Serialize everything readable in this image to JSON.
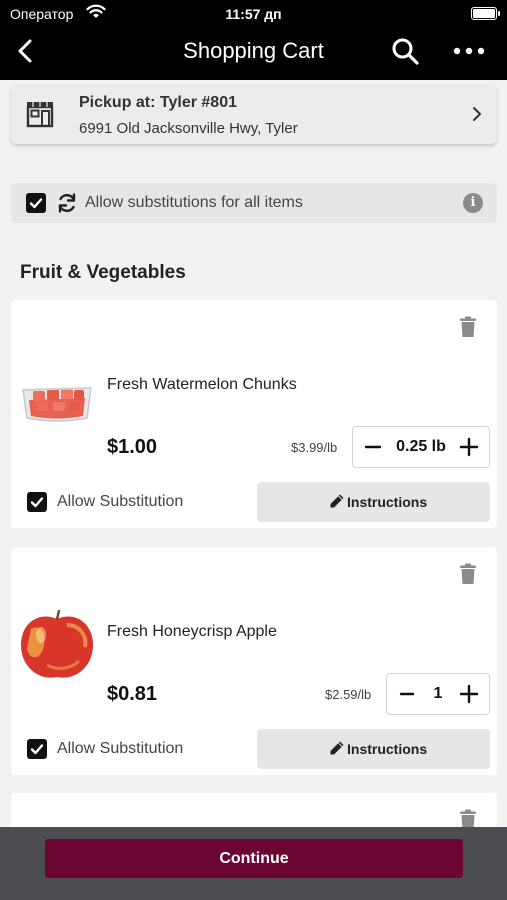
{
  "status_bar": {
    "carrier": "Оператор",
    "time": "11:57 дп",
    "battery_level": 1.0
  },
  "header": {
    "title": "Shopping Cart"
  },
  "pickup": {
    "line1": "Pickup at: Tyler #801",
    "line2": "6991 Old Jacksonville Hwy, Tyler"
  },
  "substitutions_all": {
    "checked": true,
    "label": "Allow substitutions for all items"
  },
  "section": {
    "title": "Fruit & Vegetables"
  },
  "items": [
    {
      "name": "Fresh Watermelon Chunks",
      "price": "$1.00",
      "unit_price": "$3.99/lb",
      "quantity": "0.25 lb",
      "allow_substitution": true,
      "substitution_label": "Allow Substitution",
      "instructions_label": "Instructions"
    },
    {
      "name": "Fresh Honeycrisp Apple",
      "price": "$0.81",
      "unit_price": "$2.59/lb",
      "quantity": "1",
      "allow_substitution": true,
      "substitution_label": "Allow Substitution",
      "instructions_label": "Instructions"
    }
  ],
  "footer": {
    "continue_label": "Continue"
  },
  "colors": {
    "header_bg": "#000000",
    "continue_bg": "#6b0633",
    "footer_bg": "#4b4d52"
  }
}
